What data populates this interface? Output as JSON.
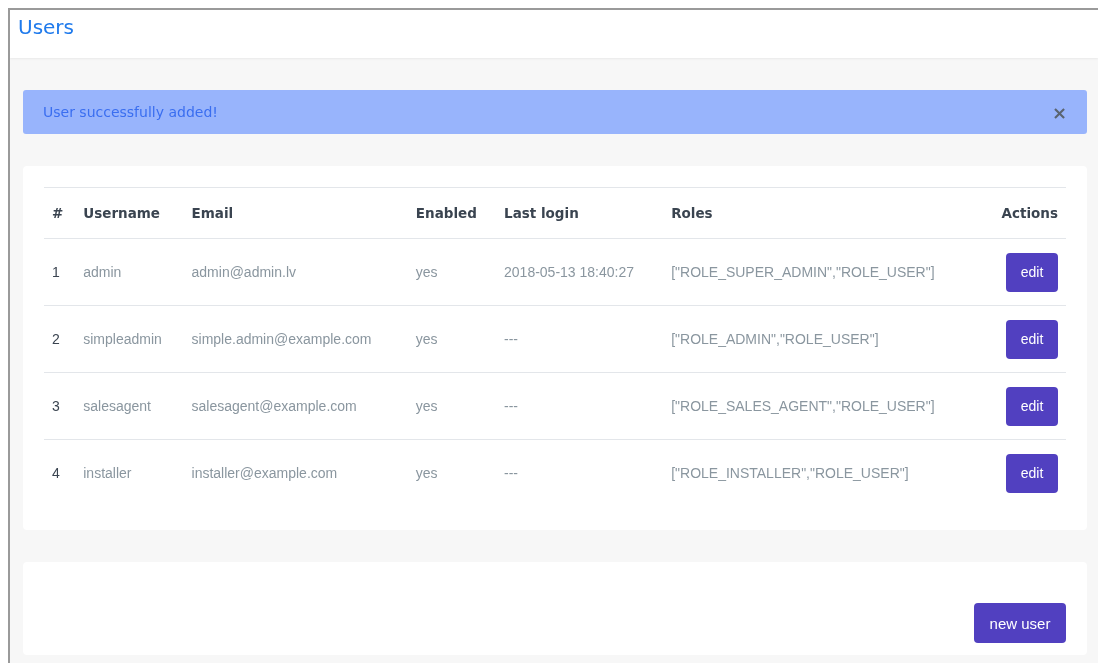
{
  "header": {
    "title": "Users"
  },
  "alert": {
    "message": "User successfully added!",
    "close": "×"
  },
  "table": {
    "columns": [
      "#",
      "Username",
      "Email",
      "Enabled",
      "Last login",
      "Roles",
      "Actions"
    ],
    "rows": [
      {
        "index": "1",
        "username": "admin",
        "email": "admin@admin.lv",
        "enabled": "yes",
        "last_login": "2018-05-13 18:40:27",
        "roles": "[\"ROLE_SUPER_ADMIN\",\"ROLE_USER\"]",
        "action": "edit"
      },
      {
        "index": "2",
        "username": "simpleadmin",
        "email": "simple.admin@example.com",
        "enabled": "yes",
        "last_login": "---",
        "roles": "[\"ROLE_ADMIN\",\"ROLE_USER\"]",
        "action": "edit"
      },
      {
        "index": "3",
        "username": "salesagent",
        "email": "salesagent@example.com",
        "enabled": "yes",
        "last_login": "---",
        "roles": "[\"ROLE_SALES_AGENT\",\"ROLE_USER\"]",
        "action": "edit"
      },
      {
        "index": "4",
        "username": "installer",
        "email": "installer@example.com",
        "enabled": "yes",
        "last_login": "---",
        "roles": "[\"ROLE_INSTALLER\",\"ROLE_USER\"]",
        "action": "edit"
      }
    ]
  },
  "footer": {
    "button": "new user"
  }
}
